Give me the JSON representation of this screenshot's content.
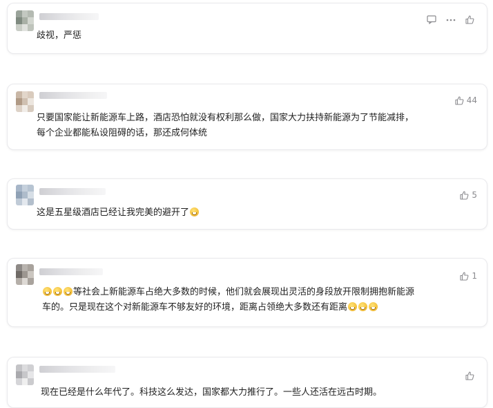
{
  "comments": [
    {
      "text": "歧视，严惩",
      "likes": ""
    },
    {
      "text": "只要国家能让新能源车上路，酒店恐怕就没有权利那么做，国家大力扶持新能源为了节能减排，\n每个企业都能私设阻碍的话，那还成何体统",
      "likes": "44"
    },
    {
      "text": "这是五星级酒店已经让我完美的避开了",
      "likes": "5"
    },
    {
      "line1": "等社会上新能源车占绝大多数的时候，他们就会展现出灵活的身段放开限制拥抱新能源",
      "line1_suffix": "",
      "line2": "车的。只是现在这个对新能源车不够友好的环境，距离占领绝大多数还有距离",
      "likes": "1"
    },
    {
      "text": "现在已经是什么年代了。科技这么发达，国家都大力推行了。一些人还活在远古时期。",
      "likes": ""
    }
  ],
  "icons": {
    "reply": "comment-icon",
    "more": "more-icon",
    "like": "thumbs-up-icon",
    "emoji": "laughing-emoji"
  }
}
